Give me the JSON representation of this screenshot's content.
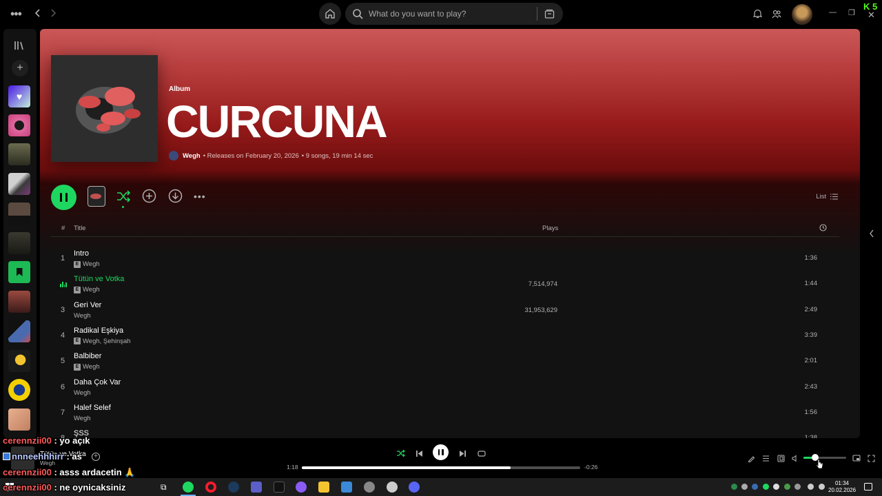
{
  "search": {
    "placeholder": "What do you want to play?"
  },
  "album": {
    "type_label": "Album",
    "title": "CURCUNA",
    "artist": "Wegh",
    "release_info": "• Releases on February 20, 2026",
    "summary": "• 9 songs, 19 min 14 sec"
  },
  "view": {
    "list_label": "List"
  },
  "table": {
    "col_num": "#",
    "col_title": "Title",
    "col_plays": "Plays"
  },
  "tracks": [
    {
      "num": "1",
      "title": "Intro",
      "artist": "Wegh",
      "explicit": true,
      "plays": "",
      "duration": "1:36",
      "playing": false
    },
    {
      "num": "2",
      "title": "Tütün ve Votka",
      "artist": "Wegh",
      "explicit": true,
      "plays": "7,514,974",
      "duration": "1:44",
      "playing": true
    },
    {
      "num": "3",
      "title": "Geri Ver",
      "artist": "Wegh",
      "explicit": false,
      "plays": "31,953,629",
      "duration": "2:49",
      "playing": false
    },
    {
      "num": "4",
      "title": "Radikal Eşkiya",
      "artist": "Wegh, Şehinşah",
      "explicit": true,
      "plays": "",
      "duration": "3:39",
      "playing": false
    },
    {
      "num": "5",
      "title": "Balbiber",
      "artist": "Wegh",
      "explicit": true,
      "plays": "",
      "duration": "2:01",
      "playing": false
    },
    {
      "num": "6",
      "title": "Daha Çok Var",
      "artist": "Wegh",
      "explicit": false,
      "plays": "",
      "duration": "2:43",
      "playing": false
    },
    {
      "num": "7",
      "title": "Halef Selef",
      "artist": "Wegh",
      "explicit": false,
      "plays": "",
      "duration": "1:56",
      "playing": false
    },
    {
      "num": "8",
      "title": "ŞSS",
      "artist": "",
      "explicit": false,
      "plays": "",
      "duration": "1:38",
      "playing": false
    }
  ],
  "player": {
    "now_playing_title": "Tütün ve Votka",
    "now_playing_artist": "Wegh",
    "elapsed": "1:18",
    "remaining": "-0:26",
    "progress_fraction": 0.75,
    "volume_fraction": 0.28
  },
  "chat": [
    {
      "user": "cerennzii00",
      "message": " : yo açık"
    },
    {
      "user": "nnneehhhirr",
      "message": " : as"
    },
    {
      "user": "cerennzii00",
      "message": " : asss ardacetin 🙏"
    },
    {
      "user": "cerennzii00",
      "message": " : ne oynicaksiniz"
    }
  ],
  "system": {
    "kick_badge": "5",
    "clock_time": "01:34",
    "clock_date": "20.02.2026"
  },
  "colors": {
    "accent": "#1ed760",
    "header_gradient_top": "#cb5858",
    "background": "#121212"
  },
  "icons": [
    "menu-dots-icon",
    "back-icon",
    "forward-icon",
    "home-icon",
    "search-icon",
    "browse-icon",
    "bell-icon",
    "friends-icon",
    "library-icon",
    "plus-icon",
    "shuffle-icon",
    "add-circle-icon",
    "download-icon",
    "more-icon",
    "list-icon",
    "clock-icon",
    "previous-icon",
    "next-icon",
    "repeat-icon",
    "lyrics-icon",
    "queue-icon",
    "connect-device-icon",
    "volume-icon",
    "miniplayer-icon",
    "fullscreen-icon"
  ]
}
